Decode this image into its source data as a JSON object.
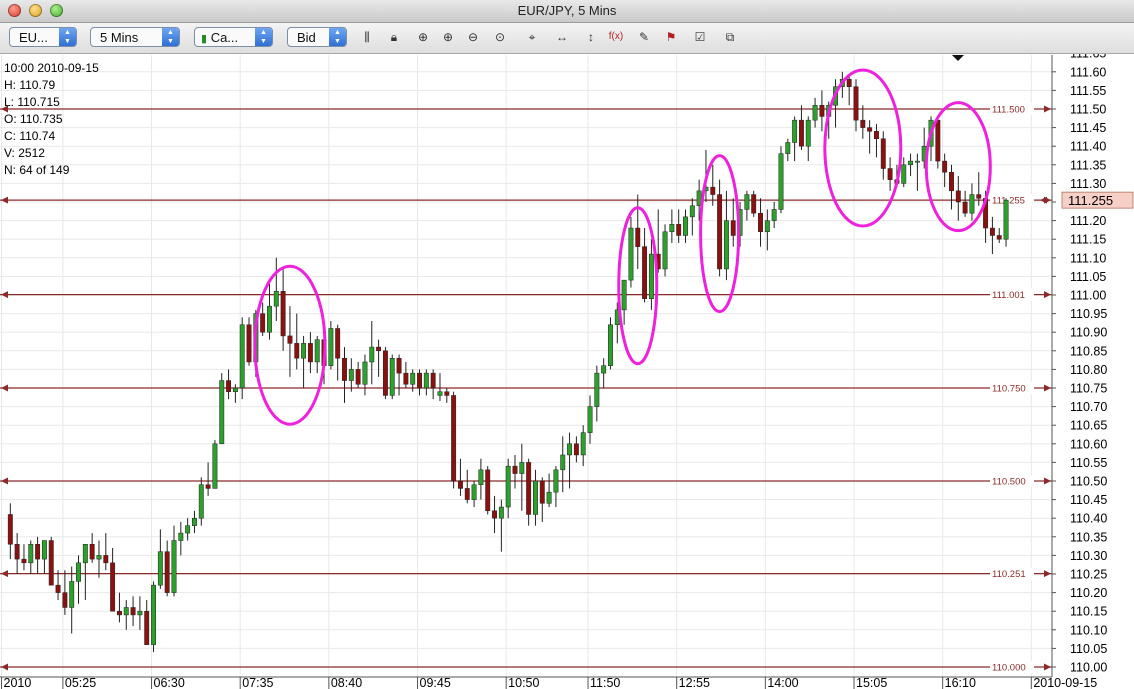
{
  "window": {
    "title": "EUR/JPY,  5 Mins"
  },
  "toolbar": {
    "symbol": "EU...",
    "interval": "5 Mins",
    "chart_style": "Ca...",
    "price_type": "Bid",
    "icons": [
      "bar-chart-icon",
      "lock-icon",
      "zoom-fit-icon",
      "zoom-in-icon",
      "zoom-out-icon",
      "zoom-reset-icon",
      "crosshair-icon",
      "horizontal-scroll-icon",
      "vertical-scale-icon",
      "indicator-function-icon",
      "drawing-tools-icon",
      "fibonacci-icon",
      "properties-icon",
      "copy-chart-icon"
    ]
  },
  "readout": {
    "date": "10:00 2010-09-15",
    "high": "H: 110.79",
    "low": "L: 110.715",
    "open": "O: 110.735",
    "close": "C: 110.74",
    "volume": "V: 2512",
    "index": "N: 64 of 149"
  },
  "colors": {
    "up": "#2ca02c",
    "down": "#8b1010",
    "level_line": "#8b2a2a",
    "highlight": "#ee22dd",
    "price_box": "#f6cfc6"
  },
  "chart_data": {
    "type": "candlestick",
    "ylim": [
      109.985,
      111.655
    ],
    "y_ticks": [
      "111.65",
      "111.60",
      "111.55",
      "111.50",
      "111.45",
      "111.40",
      "111.35",
      "111.30",
      "111.25",
      "111.20",
      "111.15",
      "111.10",
      "111.05",
      "111.00",
      "110.95",
      "110.90",
      "110.85",
      "110.80",
      "110.75",
      "110.70",
      "110.65",
      "110.60",
      "110.55",
      "110.50",
      "110.45",
      "110.40",
      "110.35",
      "110.30",
      "110.25",
      "110.20",
      "110.15",
      "110.10",
      "110.05",
      "110.00"
    ],
    "x_labels": [
      {
        "text": "2010",
        "candle": 0
      },
      {
        "text": "05:25",
        "candle": 9
      },
      {
        "text": "06:30",
        "candle": 22
      },
      {
        "text": "07:35",
        "candle": 35
      },
      {
        "text": "08:40",
        "candle": 48
      },
      {
        "text": "09:45",
        "candle": 61
      },
      {
        "text": "10:50",
        "candle": 74
      },
      {
        "text": "11:50",
        "candle": 86
      },
      {
        "text": "12:55",
        "candle": 99
      },
      {
        "text": "14:00",
        "candle": 112
      },
      {
        "text": "15:05",
        "candle": 125
      },
      {
        "text": "16:10",
        "candle": 138
      },
      {
        "text": "2010-09-15",
        "candle": 151
      }
    ],
    "levels": [
      {
        "label": "111.500",
        "price": 111.5
      },
      {
        "label": "111.255",
        "price": 111.255
      },
      {
        "label": "111.001",
        "price": 111.001
      },
      {
        "label": "110.750",
        "price": 110.75
      },
      {
        "label": "110.500",
        "price": 110.5
      },
      {
        "label": "110.251",
        "price": 110.251
      },
      {
        "label": "110.000",
        "price": 110.0
      }
    ],
    "current_price": "111.255",
    "highlight_ellipses": [
      {
        "candle": 42,
        "price": 110.865
      },
      {
        "candle": 93,
        "price": 111.025
      },
      {
        "candle": 105,
        "price": 111.165
      },
      {
        "candle": 126,
        "price": 111.395
      },
      {
        "candle": 140,
        "price": 111.345
      }
    ],
    "first_candle": 1,
    "candles": [
      [
        110.41,
        110.44,
        110.29,
        110.33
      ],
      [
        110.33,
        110.36,
        110.25,
        110.29
      ],
      [
        110.29,
        110.33,
        110.26,
        110.28
      ],
      [
        110.28,
        110.34,
        110.25,
        110.33
      ],
      [
        110.33,
        110.35,
        110.25,
        110.29
      ],
      [
        110.29,
        110.34,
        110.25,
        110.34
      ],
      [
        110.34,
        110.35,
        110.22,
        110.22
      ],
      [
        110.22,
        110.26,
        110.18,
        110.2
      ],
      [
        110.2,
        110.26,
        110.14,
        110.16
      ],
      [
        110.16,
        110.27,
        110.09,
        110.23
      ],
      [
        110.23,
        110.3,
        110.17,
        110.28
      ],
      [
        110.28,
        110.33,
        110.18,
        110.33
      ],
      [
        110.33,
        110.36,
        110.28,
        110.29
      ],
      [
        110.29,
        110.34,
        110.24,
        110.3
      ],
      [
        110.3,
        110.36,
        110.26,
        110.28
      ],
      [
        110.28,
        110.32,
        110.19,
        110.15
      ],
      [
        110.15,
        110.2,
        110.12,
        110.14
      ],
      [
        110.14,
        110.18,
        110.1,
        110.16
      ],
      [
        110.16,
        110.19,
        110.11,
        110.14
      ],
      [
        110.14,
        110.19,
        110.1,
        110.15
      ],
      [
        110.15,
        110.18,
        110.09,
        110.06
      ],
      [
        110.06,
        110.23,
        110.04,
        110.22
      ],
      [
        110.22,
        110.37,
        110.21,
        110.31
      ],
      [
        110.31,
        110.34,
        110.19,
        110.2
      ],
      [
        110.2,
        110.38,
        110.19,
        110.34
      ],
      [
        110.34,
        110.39,
        110.3,
        110.36
      ],
      [
        110.36,
        110.4,
        110.34,
        110.38
      ],
      [
        110.38,
        110.42,
        110.36,
        110.4
      ],
      [
        110.4,
        110.51,
        110.38,
        110.49
      ],
      [
        110.49,
        110.55,
        110.46,
        110.48
      ],
      [
        110.48,
        110.61,
        110.48,
        110.6
      ],
      [
        110.6,
        110.79,
        110.6,
        110.77
      ],
      [
        110.77,
        110.8,
        110.72,
        110.74
      ],
      [
        110.74,
        110.76,
        110.71,
        110.75
      ],
      [
        110.75,
        110.94,
        110.72,
        110.92
      ],
      [
        110.92,
        110.94,
        110.81,
        110.82
      ],
      [
        110.82,
        110.96,
        110.78,
        110.95
      ],
      [
        110.95,
        110.98,
        110.89,
        110.9
      ],
      [
        110.9,
        111.03,
        110.88,
        110.97
      ],
      [
        110.97,
        111.1,
        110.93,
        111.01
      ],
      [
        111.01,
        111.07,
        110.85,
        110.89
      ],
      [
        110.89,
        110.97,
        110.78,
        110.87
      ],
      [
        110.87,
        110.95,
        110.8,
        110.83
      ],
      [
        110.83,
        110.89,
        110.75,
        110.87
      ],
      [
        110.87,
        110.9,
        110.79,
        110.82
      ],
      [
        110.82,
        110.89,
        110.79,
        110.88
      ],
      [
        110.88,
        110.92,
        110.76,
        110.81
      ],
      [
        110.81,
        110.93,
        110.8,
        110.91
      ],
      [
        110.91,
        110.92,
        110.77,
        110.83
      ],
      [
        110.83,
        110.86,
        110.71,
        110.77
      ],
      [
        110.77,
        110.83,
        110.74,
        110.8
      ],
      [
        110.8,
        110.82,
        110.75,
        110.76
      ],
      [
        110.76,
        110.84,
        110.73,
        110.82
      ],
      [
        110.82,
        110.93,
        110.76,
        110.86
      ],
      [
        110.86,
        110.88,
        110.78,
        110.85
      ],
      [
        110.85,
        110.86,
        110.72,
        110.73
      ],
      [
        110.73,
        110.84,
        110.72,
        110.83
      ],
      [
        110.83,
        110.84,
        110.73,
        110.79
      ],
      [
        110.79,
        110.82,
        110.75,
        110.76
      ],
      [
        110.76,
        110.8,
        110.74,
        110.79
      ],
      [
        110.79,
        110.8,
        110.73,
        110.75
      ],
      [
        110.75,
        110.8,
        110.73,
        110.79
      ],
      [
        110.79,
        110.8,
        110.72,
        110.75
      ],
      [
        110.73,
        110.79,
        110.715,
        110.74
      ],
      [
        110.74,
        110.75,
        110.71,
        110.73
      ],
      [
        110.73,
        110.74,
        110.48,
        110.5
      ],
      [
        110.5,
        110.56,
        110.46,
        110.48
      ],
      [
        110.48,
        110.53,
        110.44,
        110.45
      ],
      [
        110.45,
        110.5,
        110.43,
        110.49
      ],
      [
        110.49,
        110.56,
        110.45,
        110.53
      ],
      [
        110.53,
        110.54,
        110.41,
        110.42
      ],
      [
        110.42,
        110.46,
        110.36,
        110.4
      ],
      [
        110.4,
        110.45,
        110.31,
        110.43
      ],
      [
        110.43,
        110.56,
        110.4,
        110.54
      ],
      [
        110.54,
        110.57,
        110.48,
        110.52
      ],
      [
        110.52,
        110.6,
        110.42,
        110.55
      ],
      [
        110.55,
        110.56,
        110.38,
        110.41
      ],
      [
        110.41,
        110.53,
        110.38,
        110.5
      ],
      [
        110.5,
        110.51,
        110.39,
        110.44
      ],
      [
        110.44,
        110.52,
        110.43,
        110.47
      ],
      [
        110.47,
        110.54,
        110.43,
        110.53
      ],
      [
        110.53,
        110.62,
        110.47,
        110.57
      ],
      [
        110.57,
        110.63,
        110.48,
        110.6
      ],
      [
        110.6,
        110.62,
        110.55,
        110.57
      ],
      [
        110.57,
        110.65,
        110.54,
        110.63
      ],
      [
        110.63,
        110.73,
        110.6,
        110.7
      ],
      [
        110.7,
        110.81,
        110.66,
        110.79
      ],
      [
        110.79,
        110.83,
        110.75,
        110.81
      ],
      [
        110.81,
        110.94,
        110.8,
        110.92
      ],
      [
        110.92,
        110.98,
        110.87,
        110.96
      ],
      [
        110.96,
        111.04,
        110.92,
        111.04
      ],
      [
        111.04,
        111.21,
        111.02,
        111.18
      ],
      [
        111.18,
        111.27,
        111.07,
        111.13
      ],
      [
        111.13,
        111.18,
        110.98,
        110.99
      ],
      [
        110.99,
        111.15,
        110.96,
        111.11
      ],
      [
        111.11,
        111.23,
        111.06,
        111.07
      ],
      [
        111.07,
        111.19,
        111.05,
        111.17
      ],
      [
        111.17,
        111.23,
        111.14,
        111.19
      ],
      [
        111.19,
        111.23,
        111.14,
        111.16
      ],
      [
        111.16,
        111.23,
        111.14,
        111.21
      ],
      [
        111.21,
        111.26,
        111.16,
        111.24
      ],
      [
        111.24,
        111.31,
        111.2,
        111.28
      ],
      [
        111.28,
        111.39,
        111.25,
        111.29
      ],
      [
        111.29,
        111.35,
        111.24,
        111.27
      ],
      [
        111.27,
        111.31,
        111.05,
        111.07
      ],
      [
        111.07,
        111.28,
        111.04,
        111.2
      ],
      [
        111.2,
        111.26,
        111.13,
        111.16
      ],
      [
        111.16,
        111.25,
        111.13,
        111.23
      ],
      [
        111.23,
        111.28,
        111.2,
        111.27
      ],
      [
        111.27,
        111.28,
        111.21,
        111.22
      ],
      [
        111.22,
        111.26,
        111.13,
        111.17
      ],
      [
        111.17,
        111.23,
        111.12,
        111.2
      ],
      [
        111.2,
        111.25,
        111.18,
        111.23
      ],
      [
        111.23,
        111.4,
        111.22,
        111.38
      ],
      [
        111.38,
        111.42,
        111.36,
        111.41
      ],
      [
        111.41,
        111.48,
        111.36,
        111.47
      ],
      [
        111.47,
        111.51,
        111.39,
        111.4
      ],
      [
        111.4,
        111.48,
        111.36,
        111.47
      ],
      [
        111.47,
        111.53,
        111.45,
        111.51
      ],
      [
        111.51,
        111.55,
        111.44,
        111.48
      ],
      [
        111.48,
        111.52,
        111.42,
        111.51
      ],
      [
        111.51,
        111.58,
        111.45,
        111.56
      ],
      [
        111.56,
        111.6,
        111.53,
        111.58
      ],
      [
        111.58,
        111.59,
        111.51,
        111.56
      ],
      [
        111.56,
        111.58,
        111.44,
        111.47
      ],
      [
        111.47,
        111.51,
        111.42,
        111.45
      ],
      [
        111.45,
        111.47,
        111.38,
        111.44
      ],
      [
        111.44,
        111.46,
        111.37,
        111.42
      ],
      [
        111.42,
        111.44,
        111.31,
        111.34
      ],
      [
        111.34,
        111.37,
        111.28,
        111.31
      ],
      [
        111.31,
        111.35,
        111.29,
        111.3
      ],
      [
        111.3,
        111.37,
        111.29,
        111.35
      ],
      [
        111.35,
        111.38,
        111.32,
        111.36
      ],
      [
        111.36,
        111.38,
        111.28,
        111.36
      ],
      [
        111.36,
        111.45,
        111.34,
        111.4
      ],
      [
        111.4,
        111.48,
        111.36,
        111.47
      ],
      [
        111.47,
        111.48,
        111.34,
        111.36
      ],
      [
        111.36,
        111.38,
        111.29,
        111.33
      ],
      [
        111.33,
        111.35,
        111.23,
        111.28
      ],
      [
        111.28,
        111.32,
        111.2,
        111.25
      ],
      [
        111.25,
        111.28,
        111.21,
        111.22
      ],
      [
        111.22,
        111.3,
        111.2,
        111.27
      ],
      [
        111.27,
        111.33,
        111.24,
        111.26
      ],
      [
        111.26,
        111.28,
        111.14,
        111.18
      ],
      [
        111.18,
        111.21,
        111.11,
        111.16
      ],
      [
        111.16,
        111.18,
        111.14,
        111.15
      ],
      [
        111.15,
        111.26,
        111.13,
        111.255
      ]
    ]
  }
}
